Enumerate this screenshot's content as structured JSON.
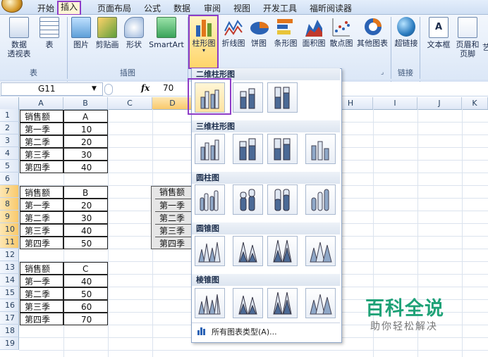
{
  "menu": {
    "items": [
      "开始",
      "插入",
      "页面布局",
      "公式",
      "数据",
      "审阅",
      "视图",
      "开发工具",
      "福昕阅读器"
    ],
    "active_index": 1
  },
  "ribbon": {
    "table_group": {
      "label": "表",
      "buttons": [
        "数据\n透视表",
        "表"
      ]
    },
    "illustrations_group": {
      "label": "插图",
      "buttons": [
        "图片",
        "剪贴画",
        "形状",
        "SmartArt"
      ]
    },
    "charts_group": {
      "buttons": [
        "柱形图",
        "折线图",
        "饼图",
        "条形图",
        "面积图",
        "散点图",
        "其他图表"
      ]
    },
    "links_group": {
      "label": "链接",
      "buttons": [
        "超链接"
      ]
    },
    "text_group": {
      "buttons": [
        "文本框",
        "页眉和\n页脚",
        "艺"
      ]
    }
  },
  "formula_bar": {
    "name_box": "G11",
    "fx": "fx",
    "value": "70"
  },
  "columns": [
    "A",
    "B",
    "C",
    "D",
    "H",
    "I",
    "J",
    "K"
  ],
  "rows": [
    "1",
    "2",
    "3",
    "4",
    "5",
    "6",
    "7",
    "8",
    "9",
    "10",
    "11",
    "12",
    "13",
    "14",
    "15",
    "16",
    "17",
    "18",
    "19"
  ],
  "table1": {
    "header": [
      "销售额",
      "A"
    ],
    "rows": [
      [
        "第一季",
        "10"
      ],
      [
        "第二季",
        "20"
      ],
      [
        "第三季",
        "30"
      ],
      [
        "第四季",
        "40"
      ]
    ]
  },
  "table2": {
    "header": [
      "销售额",
      "B"
    ],
    "rows": [
      [
        "第一季",
        "20"
      ],
      [
        "第二季",
        "30"
      ],
      [
        "第三季",
        "40"
      ],
      [
        "第四季",
        "50"
      ]
    ]
  },
  "table3": {
    "header": [
      "销售额",
      "C"
    ],
    "rows": [
      [
        "第一季",
        "40"
      ],
      [
        "第二季",
        "50"
      ],
      [
        "第三季",
        "60"
      ],
      [
        "第四季",
        "70"
      ]
    ]
  },
  "selected_range_d": [
    "销售额",
    "第一季",
    "第二季",
    "第三季",
    "第四季"
  ],
  "dropdown": {
    "sections": [
      "二维柱形图",
      "三维柱形图",
      "圆柱图",
      "圆锥图",
      "棱锥图"
    ],
    "all_types": "所有图表类型(A)..."
  },
  "watermark": {
    "title": "百科全说",
    "subtitle": "助你轻松解决"
  },
  "colors": {
    "accent_highlight": "#8e3cc7",
    "watermark_green": "#1fa277",
    "ribbon_bg": "#dbe7f7"
  }
}
